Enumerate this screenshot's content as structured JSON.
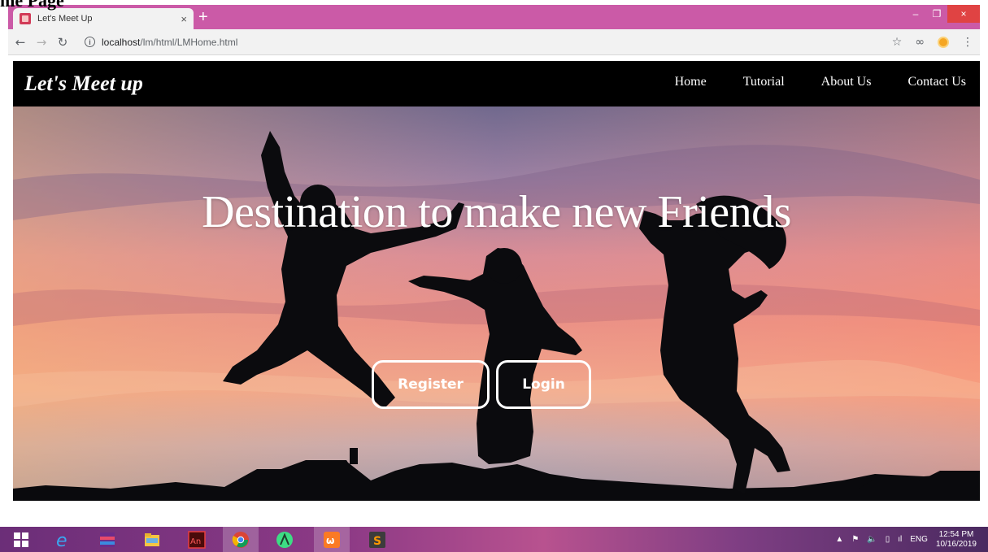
{
  "document": {
    "partial_heading": "me Page"
  },
  "browser": {
    "tab_title": "Let's Meet Up",
    "tab_close": "×",
    "new_tab": "+",
    "url_host": "localhost",
    "url_path": "/lm/html/LMHome.html",
    "window_minimize": "–",
    "window_maximize": "❐",
    "window_close": "×"
  },
  "site": {
    "brand": "Let's Meet up",
    "nav": [
      "Home",
      "Tutorial",
      "About Us",
      "Contact Us"
    ],
    "hero_title": "Destination to make new Friends",
    "register_label": "Register",
    "login_label": "Login"
  },
  "taskbar": {
    "items": [
      "windows-start",
      "internet-explorer",
      "winrar",
      "file-explorer",
      "adobe-animate",
      "chrome",
      "android-studio",
      "xampp",
      "sublime-text"
    ],
    "language": "ENG",
    "time": "12:54 PM",
    "date": "10/16/2019"
  },
  "colors": {
    "tabstrip": "#cb5aa7",
    "nav_bg": "#000000",
    "close_button": "#e04343"
  }
}
